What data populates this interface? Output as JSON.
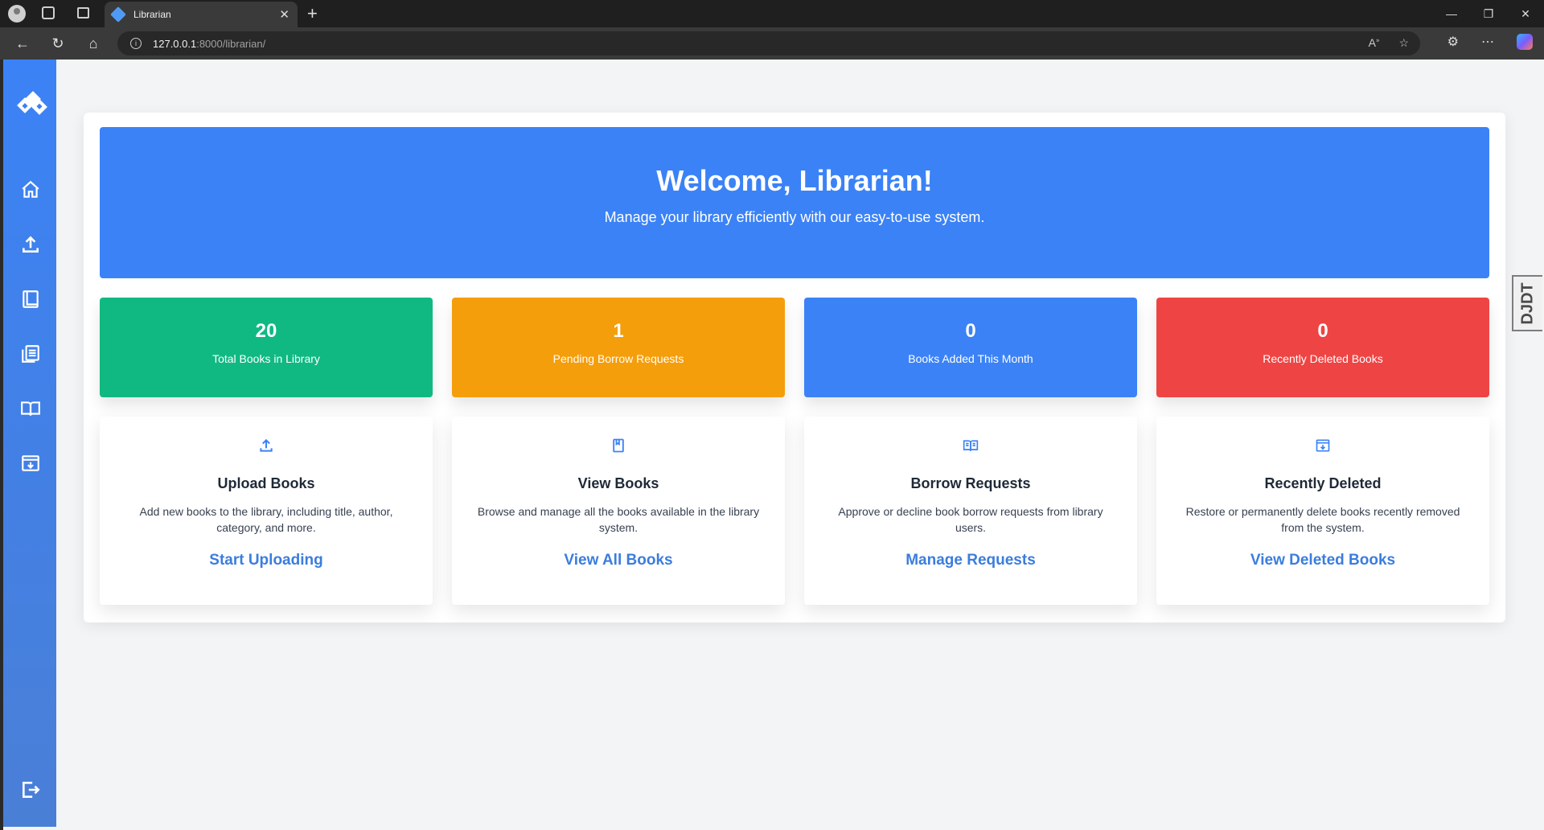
{
  "browser": {
    "tab_title": "Librarian",
    "url_host": "127.0.0.1",
    "url_path": ":8000/librarian/"
  },
  "sidebar": {
    "items": [
      "home-icon",
      "upload-icon",
      "book-icon",
      "list-icon",
      "open-book-icon",
      "archive-icon"
    ],
    "logout": "logout-icon"
  },
  "hero": {
    "title": "Welcome, Librarian!",
    "subtitle": "Manage your library efficiently with our easy-to-use system."
  },
  "stats": [
    {
      "value": "20",
      "label": "Total Books in Library",
      "color": "#10b981"
    },
    {
      "value": "1",
      "label": "Pending Borrow Requests",
      "color": "#f59e0b"
    },
    {
      "value": "0",
      "label": "Books Added This Month",
      "color": "#3b82f6"
    },
    {
      "value": "0",
      "label": "Recently Deleted Books",
      "color": "#ef4444"
    }
  ],
  "features": [
    {
      "title": "Upload Books",
      "desc": "Add new books to the library, including title, author, category, and more.",
      "link": "Start Uploading",
      "icon": "upload-icon"
    },
    {
      "title": "View Books",
      "desc": "Browse and manage all the books available in the library system.",
      "link": "View All Books",
      "icon": "book-icon"
    },
    {
      "title": "Borrow Requests",
      "desc": "Approve or decline book borrow requests from library users.",
      "link": "Manage Requests",
      "icon": "open-book-icon"
    },
    {
      "title": "Recently Deleted",
      "desc": "Restore or permanently delete books recently removed from the system.",
      "link": "View Deleted Books",
      "icon": "archive-icon"
    }
  ],
  "debug_toolbar": {
    "label": "DJDT"
  }
}
